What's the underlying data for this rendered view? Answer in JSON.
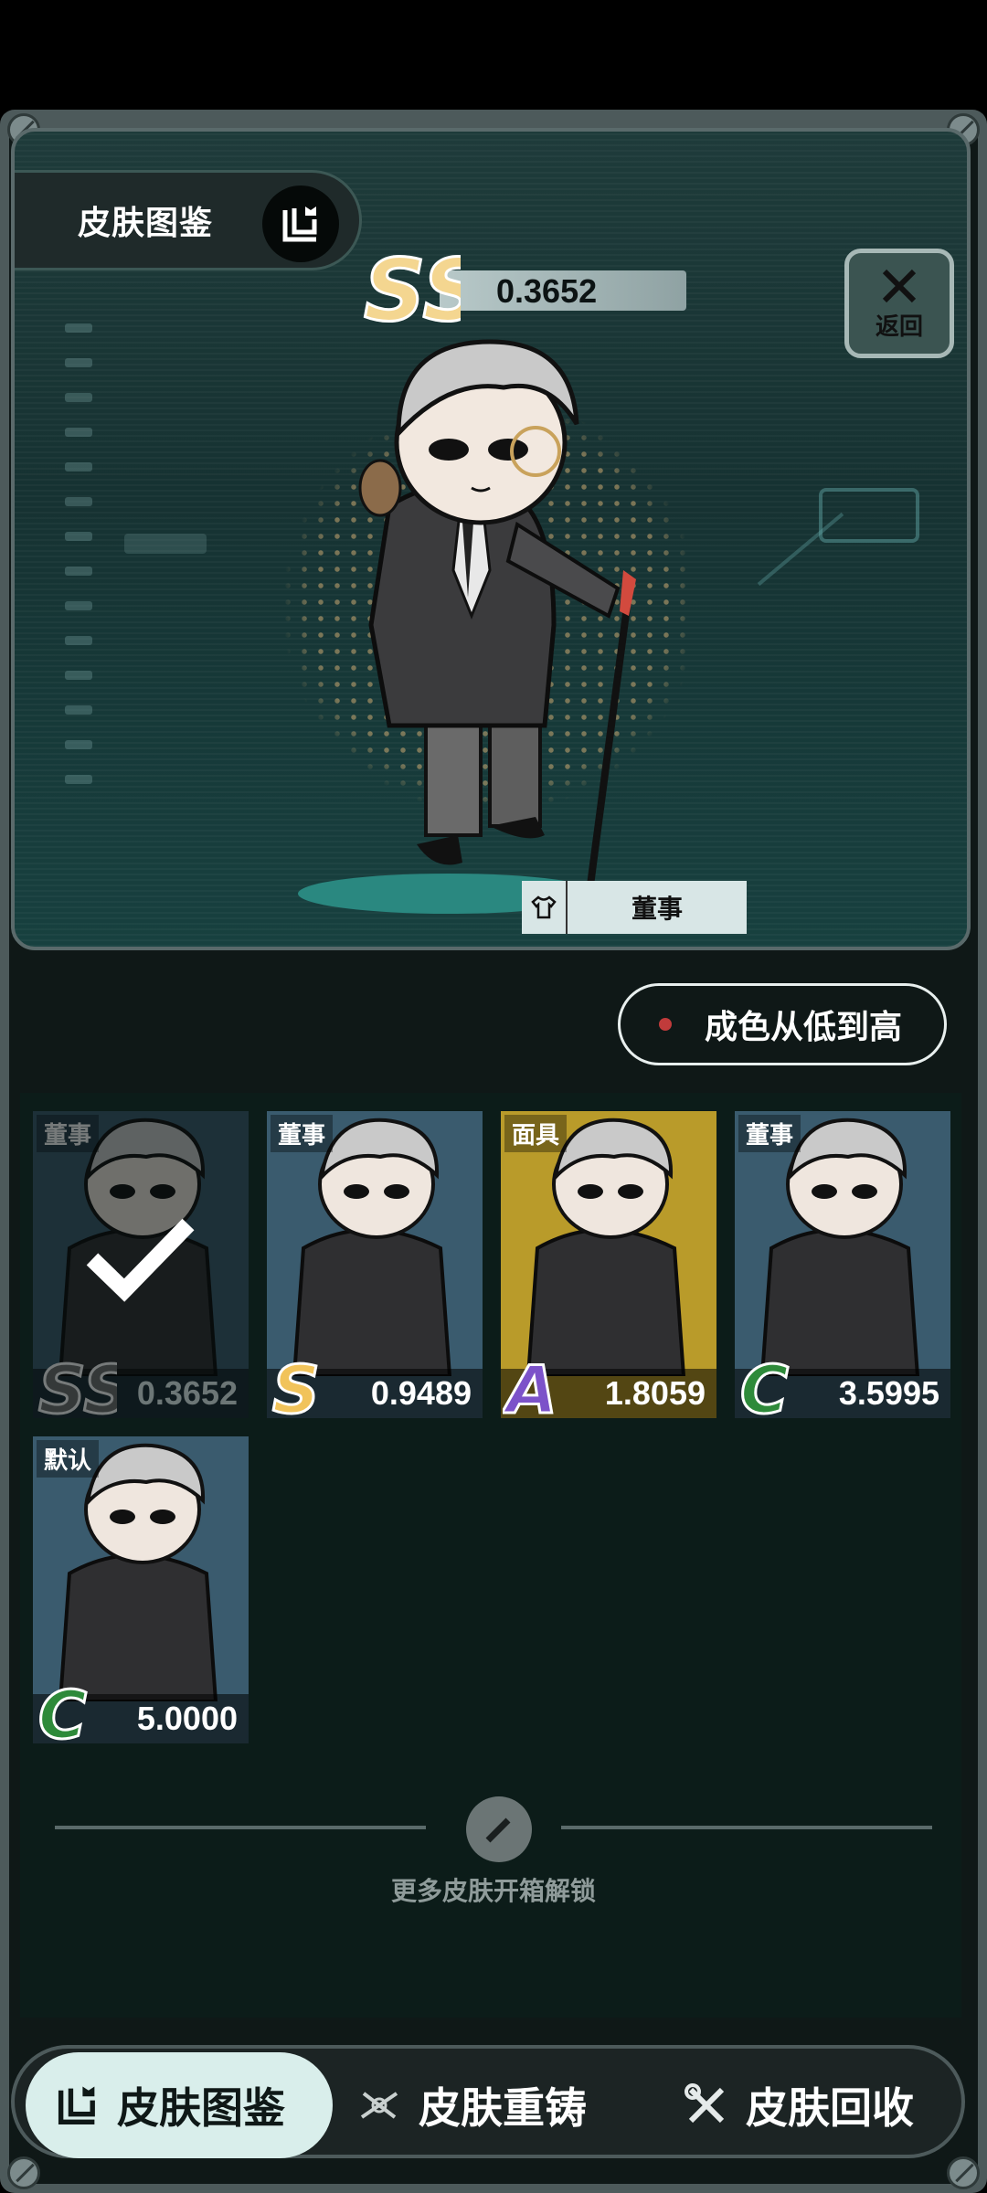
{
  "header": {
    "title": "皮肤图鉴",
    "back_label": "返回"
  },
  "current": {
    "grade": "SS",
    "value": "0.3652",
    "skin_name": "董事"
  },
  "sort": {
    "label": "成色从低到高"
  },
  "skins": [
    {
      "name": "董事",
      "grade": "SS",
      "value": "0.3652",
      "selected": true,
      "grade_color": "#6f6f6f"
    },
    {
      "name": "董事",
      "grade": "S",
      "value": "0.9489",
      "selected": false,
      "grade_color": "#f1c35a"
    },
    {
      "name": "面具",
      "grade": "A",
      "value": "1.8059",
      "selected": false,
      "grade_color": "#7c52c9"
    },
    {
      "name": "董事",
      "grade": "C",
      "value": "3.5995",
      "selected": false,
      "grade_color": "#2e8a3a"
    },
    {
      "name": "默认",
      "grade": "C",
      "value": "5.0000",
      "selected": false,
      "grade_color": "#2e8a3a"
    }
  ],
  "more": {
    "text": "更多皮肤开箱解锁"
  },
  "tabs": [
    {
      "label": "皮肤图鉴",
      "icon": "catalog-icon",
      "active": true
    },
    {
      "label": "皮肤重铸",
      "icon": "recast-icon",
      "active": false
    },
    {
      "label": "皮肤回收",
      "icon": "recycle-tools-icon",
      "active": false
    }
  ],
  "colors": {
    "accent": "#d9eeeb",
    "panel": "#0c1c19",
    "frame": "#4d5a5b",
    "sort_dot": "#c13b3b"
  }
}
